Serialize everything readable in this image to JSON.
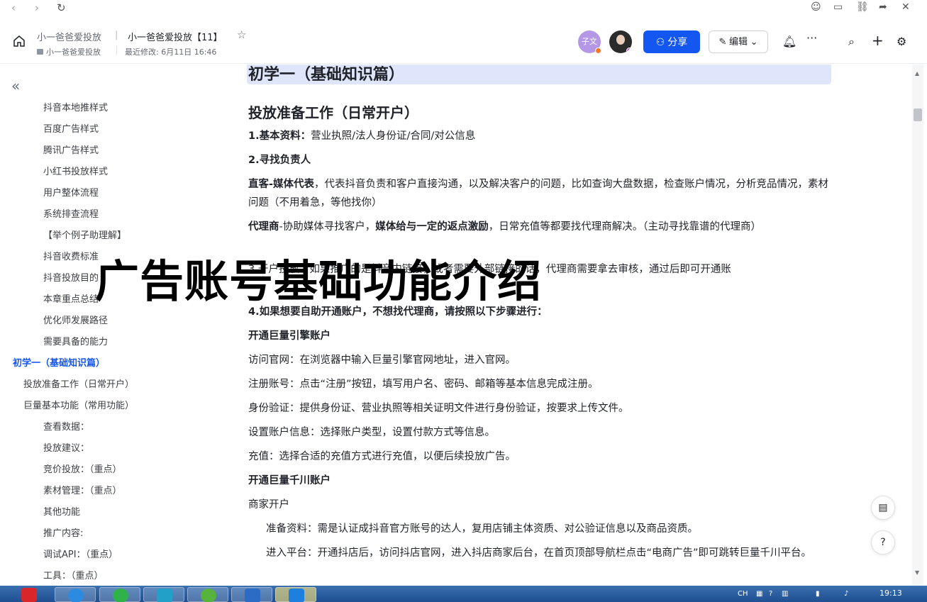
{
  "header": {
    "breadcrumb_parent": "小一爸爸爱投放",
    "breadcrumb_sep": "|",
    "doc_title": "小一爸爸爱投放【11】",
    "folder": "小一爸爸爱投放",
    "last_modified": "最近修改: 6月11日 16:46",
    "avatar_initials": "子文",
    "share_label": "分享",
    "edit_label": "编辑"
  },
  "sidebar": {
    "items": [
      {
        "label": "抖音本地推样式",
        "level": 2
      },
      {
        "label": "百度广告样式",
        "level": 2
      },
      {
        "label": "腾讯广告样式",
        "level": 2
      },
      {
        "label": "小红书投放样式",
        "level": 2
      },
      {
        "label": "用户整体流程",
        "level": 2
      },
      {
        "label": "系统排查流程",
        "level": 2
      },
      {
        "label": "【举个例子助理解】",
        "level": 2
      },
      {
        "label": "抖音收费标准",
        "level": 2
      },
      {
        "label": "抖音投放目的",
        "level": 2
      },
      {
        "label": "本章重点总结",
        "level": 2
      },
      {
        "label": "优化师发展路径",
        "level": 2
      },
      {
        "label": "需要具备的能力",
        "level": 2
      },
      {
        "label": "初学一（基础知识篇）",
        "level": 0,
        "active": true
      },
      {
        "label": "投放准备工作（日常开户）",
        "level": 1
      },
      {
        "label": "巨量基本功能（常用功能）",
        "level": 1
      },
      {
        "label": "查看数据：",
        "level": 2
      },
      {
        "label": "投放建议：",
        "level": 2
      },
      {
        "label": "竞价投放：（重点）",
        "level": 2
      },
      {
        "label": "素材管理：（重点）",
        "level": 2
      },
      {
        "label": "其他功能",
        "level": 2
      },
      {
        "label": "推广内容:",
        "level": 2
      },
      {
        "label": "调试API：（重点）",
        "level": 2
      },
      {
        "label": "工具：（重点）",
        "level": 2
      }
    ]
  },
  "content": {
    "h1": "初学一（基础知识篇）",
    "h2": "投放准备工作（日常开户）",
    "p1_bold": "1.基本资料：",
    "p1_text": "营业执照/法人身份证/合同/对公信息",
    "p2_bold": "2.寻找负责人",
    "p3_bold": "直客-媒体代表",
    "p3_text": "，代表抖音负责和客户直接沟通，以及解决客户的问题，比如查询大盘数据，检查账户情况，分析竞品情况，素材问题（不用着急，等他找你）",
    "p4_bold1": "代理商",
    "p4_text1": "-协助媒体寻找客户，",
    "p4_bold2": "媒体给与一定的返点激励",
    "p4_text2": "，日常充值等都要找代理商解决。（主动寻找靠谱的代理商）",
    "p5_text": "3.开户投放：如果推广的是抖音内链接，或者需要外部链接的话，代理商需要拿去审核，通过后即可开通账",
    "p6_bold": "4.如果想要自助开通账户，不想找代理商，请按照以下步骤进行：",
    "p7_bold": "开通巨量引擎账户",
    "p8": "访问官网：在浏览器中输入巨量引擎官网地址，进入官网。",
    "p9": "注册账号：点击“注册”按钮，填写用户名、密码、邮箱等基本信息完成注册。",
    "p10": "身份验证：提供身份证、营业执照等相关证明文件进行身份验证，按要求上传文件。",
    "p11": "设置账户信息：选择账户类型，设置付款方式等信息。",
    "p12": "充值：选择合适的充值方式进行充值，以便后续投放广告。",
    "p13_bold": "开通巨量千川账户",
    "p14": "商家开户",
    "p15": "准备资料：需是认证成抖音官方账号的达人，复用店铺主体资质、对公验证信息以及商品资质。",
    "p16": "进入平台：开通抖店后，访问抖店官网，进入抖店商家后台，在首页顶部导航栏点击“电商广告”即可跳转巨量千川平台。"
  },
  "overlay": {
    "title": "广告账号基础功能介绍"
  },
  "taskbar": {
    "clock": "19:13"
  },
  "colors": {
    "accent": "#1456f0",
    "heading_band": "#dfe5fb",
    "taskbar": "#2a5c9e"
  }
}
